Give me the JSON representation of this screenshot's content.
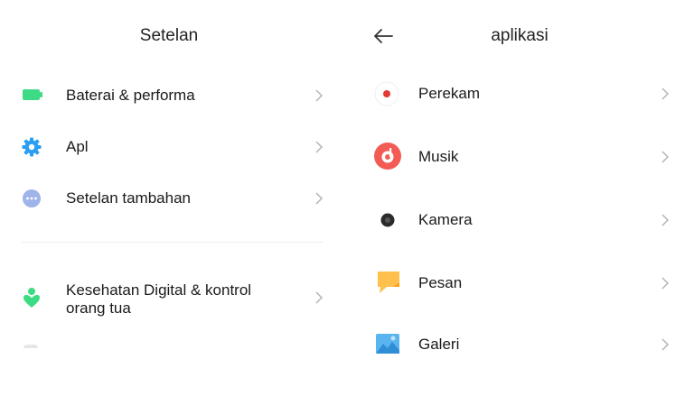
{
  "left_screen": {
    "title": "Setelan",
    "items": [
      {
        "label": "Baterai & performa",
        "icon": "battery-icon",
        "color": "#3ddc84"
      },
      {
        "label": "Apl",
        "icon": "gear-icon",
        "color": "#2a9df4"
      },
      {
        "label": "Setelan tambahan",
        "icon": "more-dots-icon",
        "color": "#9fb4e8"
      },
      {
        "label": "Kesehatan Digital & kontrol orang tua",
        "icon": "digital-wellbeing-icon",
        "color": "#3ddc84"
      }
    ]
  },
  "right_screen": {
    "title": "aplikasi",
    "back_icon": "back-arrow-icon",
    "items": [
      {
        "label": "Perekam",
        "icon": "recorder-icon",
        "color": "#e53935"
      },
      {
        "label": "Musik",
        "icon": "music-icon",
        "color": "#f25c54"
      },
      {
        "label": "Kamera",
        "icon": "camera-icon",
        "color": "#2b2b2b"
      },
      {
        "label": "Pesan",
        "icon": "messages-icon",
        "color": "#ffc04d"
      },
      {
        "label": "Galeri",
        "icon": "gallery-icon",
        "color": "#5ab4f0"
      }
    ]
  }
}
